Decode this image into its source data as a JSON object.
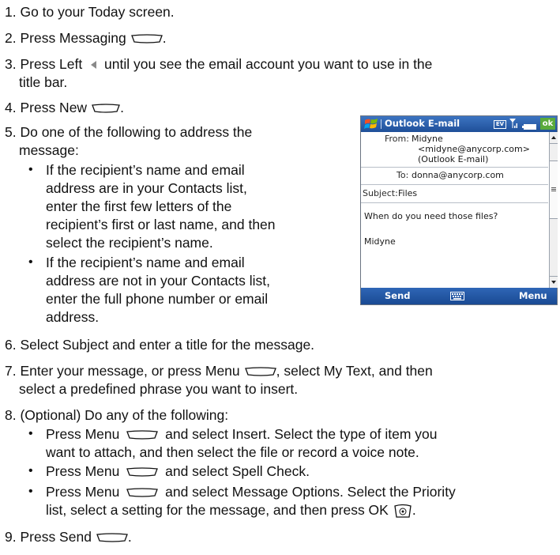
{
  "steps": {
    "s1": "1. Go to your Today screen.",
    "s2": "2. Press Messaging",
    "s3a": "3. Press Left",
    "s3b": "until you see the email account you want to use in the",
    "s3c": "title bar.",
    "s4": "4. Press New",
    "s5a": "5. Do one of the following to address the",
    "s5b": "message:",
    "b1": [
      "If the recipient’s name and email",
      "address are in your Contacts list,",
      "enter the first few letters of the",
      "recipient’s first or last name, and then",
      "select the recipient’s name."
    ],
    "b2": [
      "If the recipient’s name and email",
      "address are not in your Contacts list,",
      "enter the full phone number or email",
      "address."
    ],
    "s6": "6. Select Subject and enter a title for the message.",
    "s7a": "7. Enter your message, or press Menu",
    "s7b": ", select My Text, and then",
    "s7c": "select a predefined phrase you want to insert.",
    "s8": "8. (Optional) Do any of the following:",
    "b3a": "Press Menu",
    "b3b": "and select Insert. Select the type of item you",
    "b3c": "want to attach, and then select the file or record a voice note.",
    "b4a": "Press Menu",
    "b4b": "and select Spell Check.",
    "b5a": "Press Menu",
    "b5b": "and select Message Options. Select the Priority",
    "b5c": "list, select a setting for the message, and then press OK",
    "s9a": "9. Press Send",
    "s9b": ".",
    "period": ".",
    "bullet": "•"
  },
  "phone": {
    "title": "Outlook E-mail",
    "ev_label": "EV",
    "ok_label": "ok",
    "from_label": "From:",
    "from_lines": [
      "Midyne",
      "<midyne@anycorp.com>",
      "(Outlook E-mail)"
    ],
    "to_label": "To:",
    "to_value": "donna@anycorp.com",
    "subject_label": "Subject:",
    "subject_value": "Files",
    "body_line": "When do you need those files?",
    "signature": "Midyne",
    "send_label": "Send",
    "menu_label": "Menu",
    "icons": [
      "windows-flag-icon",
      "signal-icon",
      "battery-icon",
      "keyboard-icon"
    ],
    "colors": {
      "titlebar": "#1f4f98",
      "ok": "#5aaa3a"
    }
  }
}
